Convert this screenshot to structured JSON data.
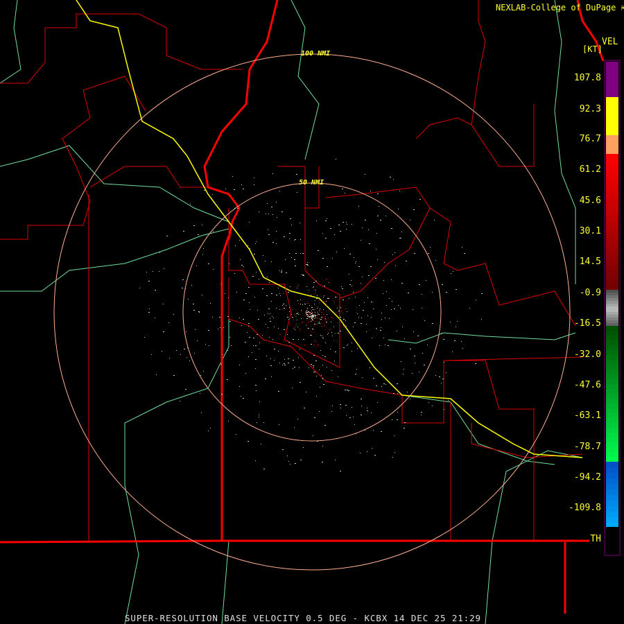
{
  "attribution": "NEXLAB-College of DuPage",
  "attribution_icon": "logo-arrow-icon",
  "legend": {
    "product": "VEL",
    "unit": "[KT]",
    "labels": [
      "107.8",
      "92.3",
      "76.7",
      "61.2",
      "45.6",
      "30.1",
      "14.5",
      "-0.9",
      "-16.5",
      "-32.0",
      "-47.6",
      "-63.1",
      "-78.7",
      "-94.2",
      "-109.8",
      "TH"
    ],
    "colors": {
      "purple": "#800080",
      "yellow": "#ffff00",
      "orange": "#ffa060",
      "red": "#ff0000",
      "dark_red": "#700000",
      "gray": "#c0c0c0",
      "dark_green": "#005000",
      "bright_green": "#00ff50",
      "blue": "#0050c8",
      "light_blue": "#00b0ff"
    }
  },
  "range_rings": [
    {
      "label": "100 NMI"
    },
    {
      "label": "50 NMI"
    }
  ],
  "map_colors": {
    "state_border": "#ff0000",
    "county_border": "#e00000",
    "highway": "#ffff00",
    "river": "#70e0a0",
    "range_ring": "#ffb090"
  },
  "footer": "SUPER-RESOLUTION BASE VELOCITY 0.5 DEG - KCBX 14 DEC 25 21:29"
}
